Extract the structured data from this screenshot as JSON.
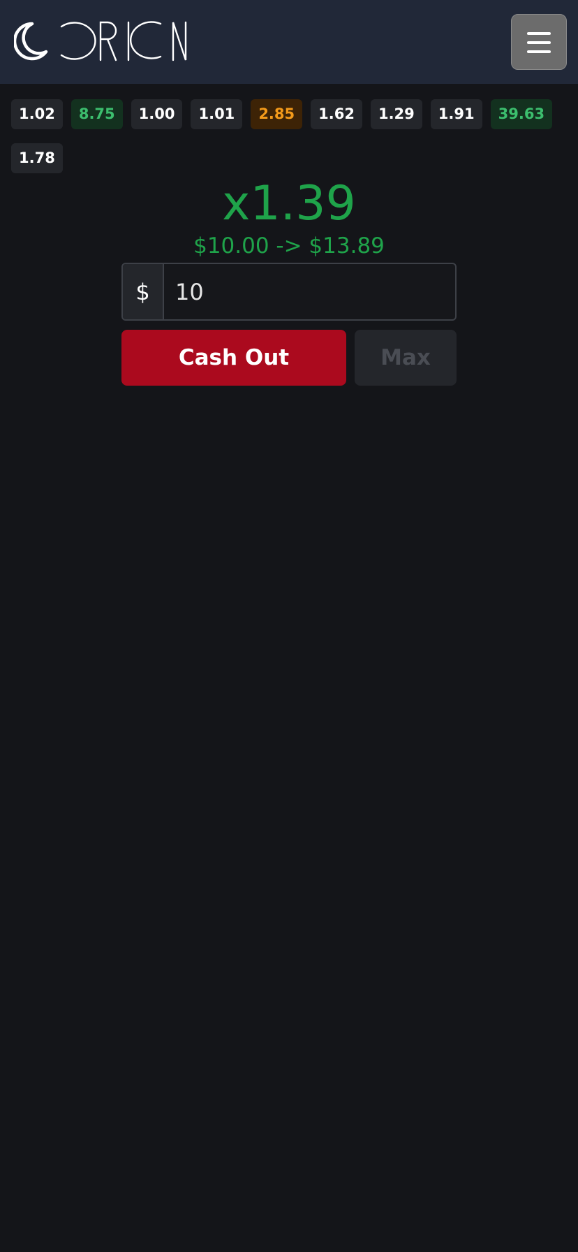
{
  "header": {
    "logo_text": "ORION",
    "logo_icon": "moon-icon",
    "menu_icon": "hamburger-menu-icon"
  },
  "history": [
    {
      "value": "1.02",
      "tone": "neutral"
    },
    {
      "value": "8.75",
      "tone": "green"
    },
    {
      "value": "1.00",
      "tone": "neutral"
    },
    {
      "value": "1.01",
      "tone": "neutral"
    },
    {
      "value": "2.85",
      "tone": "orange"
    },
    {
      "value": "1.62",
      "tone": "neutral"
    },
    {
      "value": "1.29",
      "tone": "neutral"
    },
    {
      "value": "1.91",
      "tone": "neutral"
    },
    {
      "value": "39.63",
      "tone": "green"
    },
    {
      "value": "1.78",
      "tone": "neutral"
    }
  ],
  "game": {
    "multiplier": "x1.39",
    "payout": "$10.00 -> $13.89"
  },
  "bet": {
    "currency": "$",
    "amount": "10"
  },
  "actions": {
    "cashout_label": "Cash Out",
    "max_label": "Max"
  },
  "colors": {
    "header_bg": "#212838",
    "page_bg": "#141519",
    "win_green": "#1fa34a",
    "cashout_red": "#ab0a1e",
    "chip_green_text": "#3cbe6e",
    "chip_orange_text": "#f39a1a"
  }
}
